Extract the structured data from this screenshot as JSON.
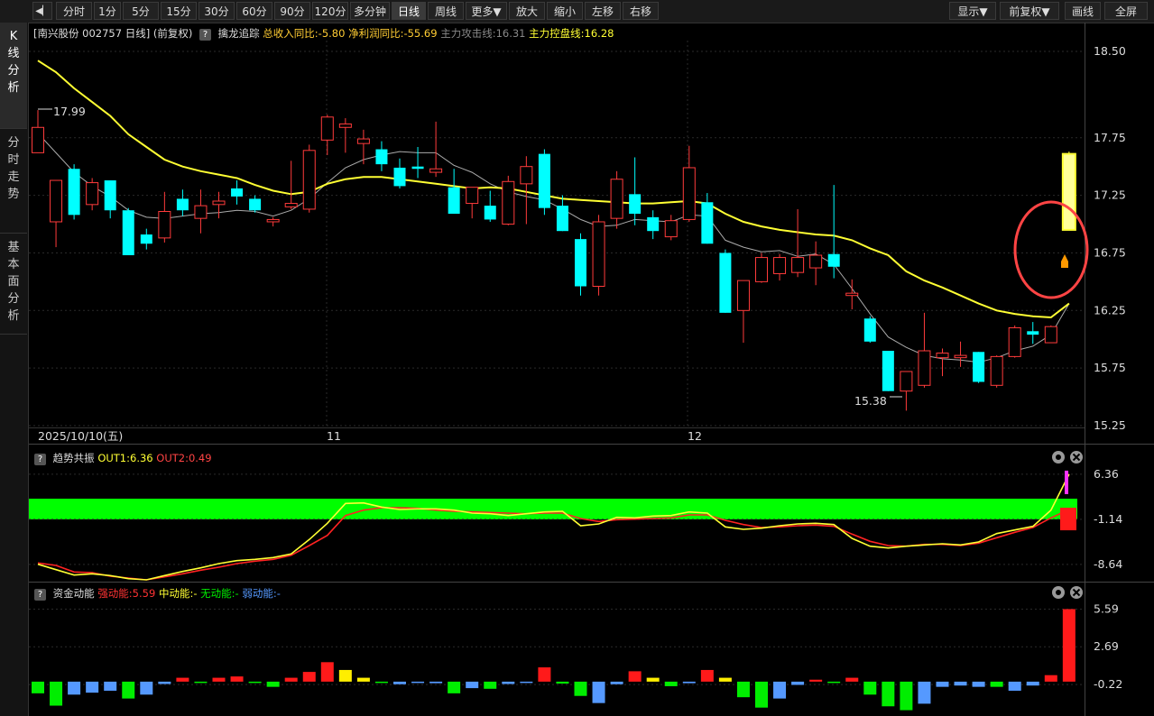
{
  "toolbar": {
    "items": [
      "分时",
      "1分",
      "5分",
      "15分",
      "30分",
      "60分",
      "90分",
      "120分",
      "多分钟",
      "日线",
      "周线",
      "更多▼",
      "放大",
      "缩小",
      "左移",
      "右移"
    ],
    "active": "日线",
    "right_items": [
      "显示▼",
      "前复权▼",
      "画线",
      "全屏"
    ]
  },
  "sidebar": {
    "tabs": [
      {
        "label": "K\n线\n分\n析",
        "active": true
      },
      {
        "label": "分\n时\n走\n势",
        "active": false
      },
      {
        "label": "基\n本\n面\n分\n析",
        "active": false
      }
    ]
  },
  "main": {
    "stock": "[南兴股份 002757 日线]",
    "adjust": "(前复权)",
    "indicator_name": "擒龙追踪",
    "rev_yoy": "总收入同比:-5.80",
    "profit_yoy": "净利润同比:-55.69",
    "attack_line": "主力攻击线:16.31",
    "control_line": "主力控盘线:16.28",
    "high_label": "17.99",
    "low_label": "15.38",
    "date_label": "2025/10/10(五)",
    "month_labels": [
      "11",
      "12"
    ],
    "y_ticks": [
      "18.50",
      "17.75",
      "17.25",
      "16.75",
      "16.25",
      "15.75",
      "15.25"
    ]
  },
  "panel2": {
    "name": "趋势共振",
    "out1": "OUT1:6.36",
    "out2": "OUT2:0.49",
    "y_ticks": [
      "6.36",
      "-1.14",
      "-8.64"
    ]
  },
  "panel3": {
    "name": "资金动能",
    "strong": "强动能:5.59",
    "mid": "中动能:-",
    "none": "无动能:-",
    "weak": "弱动能:-",
    "y_ticks": [
      "5.59",
      "2.69",
      "-0.22"
    ]
  },
  "colors": {
    "up": "#ff3b3b",
    "down": "#00ffff",
    "ma_yellow": "#ffff33",
    "ma_gray": "#aaaaaa",
    "band_green": "#00ff00",
    "bar_red": "#ff1a1a",
    "bar_yellow": "#ffee00",
    "bar_green": "#00ee00",
    "bar_blue": "#5599ff",
    "highlight": "#ff4444"
  },
  "chart_data": [
    {
      "type": "candlestick",
      "ylim": [
        15.25,
        18.5
      ],
      "candles": [
        {
          "o": 17.62,
          "h": 17.99,
          "l": 17.62,
          "c": 17.84
        },
        {
          "o": 17.02,
          "h": 17.38,
          "l": 16.8,
          "c": 17.38
        },
        {
          "o": 17.48,
          "h": 17.52,
          "l": 17.04,
          "c": 17.08
        },
        {
          "o": 17.17,
          "h": 17.4,
          "l": 17.12,
          "c": 17.36
        },
        {
          "o": 17.38,
          "h": 17.38,
          "l": 17.05,
          "c": 17.12
        },
        {
          "o": 17.12,
          "h": 17.14,
          "l": 16.73,
          "c": 16.73
        },
        {
          "o": 16.91,
          "h": 16.96,
          "l": 16.78,
          "c": 16.83
        },
        {
          "o": 16.88,
          "h": 17.28,
          "l": 16.84,
          "c": 17.11
        },
        {
          "o": 17.22,
          "h": 17.3,
          "l": 17.07,
          "c": 17.12
        },
        {
          "o": 17.05,
          "h": 17.3,
          "l": 16.92,
          "c": 17.16
        },
        {
          "o": 17.17,
          "h": 17.28,
          "l": 17.05,
          "c": 17.2
        },
        {
          "o": 17.31,
          "h": 17.38,
          "l": 17.17,
          "c": 17.24
        },
        {
          "o": 17.22,
          "h": 17.25,
          "l": 17.1,
          "c": 17.12
        },
        {
          "o": 17.02,
          "h": 17.06,
          "l": 16.98,
          "c": 17.04
        },
        {
          "o": 17.15,
          "h": 17.55,
          "l": 17.13,
          "c": 17.18
        },
        {
          "o": 17.13,
          "h": 17.69,
          "l": 17.1,
          "c": 17.64
        },
        {
          "o": 17.73,
          "h": 17.95,
          "l": 17.6,
          "c": 17.93
        },
        {
          "o": 17.84,
          "h": 17.92,
          "l": 17.62,
          "c": 17.87
        },
        {
          "o": 17.7,
          "h": 17.82,
          "l": 17.52,
          "c": 17.74
        },
        {
          "o": 17.65,
          "h": 17.72,
          "l": 17.46,
          "c": 17.52
        },
        {
          "o": 17.49,
          "h": 17.57,
          "l": 17.31,
          "c": 17.33
        },
        {
          "o": 17.5,
          "h": 17.67,
          "l": 17.4,
          "c": 17.48
        },
        {
          "o": 17.45,
          "h": 17.89,
          "l": 17.41,
          "c": 17.48
        },
        {
          "o": 17.32,
          "h": 17.48,
          "l": 17.12,
          "c": 17.09
        },
        {
          "o": 17.18,
          "h": 17.32,
          "l": 17.05,
          "c": 17.32
        },
        {
          "o": 17.16,
          "h": 17.29,
          "l": 17.02,
          "c": 17.04
        },
        {
          "o": 17.0,
          "h": 17.42,
          "l": 16.99,
          "c": 17.37
        },
        {
          "o": 17.35,
          "h": 17.59,
          "l": 17.0,
          "c": 17.5
        },
        {
          "o": 17.61,
          "h": 17.65,
          "l": 17.08,
          "c": 17.14
        },
        {
          "o": 17.16,
          "h": 17.25,
          "l": 16.94,
          "c": 16.94
        },
        {
          "o": 16.87,
          "h": 16.92,
          "l": 16.38,
          "c": 16.46
        },
        {
          "o": 16.46,
          "h": 17.08,
          "l": 16.38,
          "c": 17.02
        },
        {
          "o": 17.05,
          "h": 17.46,
          "l": 16.96,
          "c": 17.39
        },
        {
          "o": 17.26,
          "h": 17.58,
          "l": 16.99,
          "c": 17.09
        },
        {
          "o": 17.06,
          "h": 17.12,
          "l": 16.87,
          "c": 16.94
        },
        {
          "o": 16.89,
          "h": 17.08,
          "l": 16.86,
          "c": 17.03
        },
        {
          "o": 17.04,
          "h": 17.68,
          "l": 17.02,
          "c": 17.49
        },
        {
          "o": 17.19,
          "h": 17.27,
          "l": 16.87,
          "c": 16.83
        },
        {
          "o": 16.75,
          "h": 16.78,
          "l": 16.41,
          "c": 16.23
        },
        {
          "o": 16.25,
          "h": 16.45,
          "l": 15.97,
          "c": 16.51
        },
        {
          "o": 16.5,
          "h": 16.75,
          "l": 16.49,
          "c": 16.71
        },
        {
          "o": 16.57,
          "h": 16.74,
          "l": 16.51,
          "c": 16.71
        },
        {
          "o": 16.58,
          "h": 17.13,
          "l": 16.54,
          "c": 16.71
        },
        {
          "o": 16.62,
          "h": 16.85,
          "l": 16.47,
          "c": 16.73
        },
        {
          "o": 16.74,
          "h": 17.34,
          "l": 16.53,
          "c": 16.63
        },
        {
          "o": 16.38,
          "h": 16.52,
          "l": 16.26,
          "c": 16.4
        },
        {
          "o": 16.18,
          "h": 16.2,
          "l": 15.97,
          "c": 15.98
        },
        {
          "o": 15.9,
          "h": 15.9,
          "l": 15.55,
          "c": 15.55
        },
        {
          "o": 15.55,
          "h": 15.38,
          "l": 15.38,
          "c": 15.72
        },
        {
          "o": 15.6,
          "h": 16.23,
          "l": 15.58,
          "c": 15.9
        },
        {
          "o": 15.84,
          "h": 15.92,
          "l": 15.68,
          "c": 15.88
        },
        {
          "o": 15.84,
          "h": 15.98,
          "l": 15.76,
          "c": 15.86
        },
        {
          "o": 15.89,
          "h": 15.89,
          "l": 15.62,
          "c": 15.63
        },
        {
          "o": 15.6,
          "h": 15.86,
          "l": 15.58,
          "c": 15.85
        },
        {
          "o": 15.85,
          "h": 16.12,
          "l": 15.84,
          "c": 16.1
        },
        {
          "o": 16.07,
          "h": 16.15,
          "l": 15.96,
          "c": 16.04
        },
        {
          "o": 15.97,
          "h": 16.12,
          "l": 15.97,
          "c": 16.11
        },
        {
          "o": 16.95,
          "h": 17.63,
          "l": 16.95,
          "c": 17.61
        }
      ],
      "ma_yellow": [
        18.42,
        18.32,
        18.18,
        18.06,
        17.94,
        17.78,
        17.67,
        17.56,
        17.5,
        17.46,
        17.43,
        17.4,
        17.34,
        17.29,
        17.26,
        17.28,
        17.35,
        17.39,
        17.41,
        17.41,
        17.39,
        17.37,
        17.35,
        17.33,
        17.31,
        17.32,
        17.31,
        17.28,
        17.25,
        17.22,
        17.21,
        17.2,
        17.19,
        17.18,
        17.18,
        17.19,
        17.2,
        17.18,
        17.09,
        17.02,
        16.98,
        16.95,
        16.93,
        16.91,
        16.9,
        16.86,
        16.79,
        16.73,
        16.59,
        16.51,
        16.45,
        16.38,
        16.31,
        16.25,
        16.22,
        16.2,
        16.19,
        16.31
      ],
      "ma_gray": [
        17.79,
        17.62,
        17.45,
        17.33,
        17.24,
        17.12,
        17.06,
        17.05,
        17.07,
        17.09,
        17.1,
        17.12,
        17.11,
        17.07,
        17.12,
        17.22,
        17.36,
        17.49,
        17.56,
        17.6,
        17.63,
        17.62,
        17.62,
        17.51,
        17.45,
        17.35,
        17.28,
        17.24,
        17.21,
        17.13,
        17.04,
        16.98,
        16.99,
        17.04,
        17.03,
        17.02,
        17.08,
        17.07,
        16.86,
        16.8,
        16.76,
        16.77,
        16.72,
        16.74,
        16.65,
        16.44,
        16.22,
        16.02,
        15.93,
        15.86,
        15.83,
        15.82,
        15.8,
        15.84,
        15.9,
        15.94,
        16.04,
        16.31
      ]
    },
    {
      "type": "line",
      "ylim": [
        -11.5,
        8.0
      ],
      "band": [
        -1.14,
        0.8
      ],
      "series": [
        {
          "name": "OUT1",
          "values": [
            -8.6,
            -9.5,
            -10.4,
            -10.2,
            -10.5,
            -11.0,
            -11.2,
            -10.5,
            -9.8,
            -9.2,
            -8.5,
            -8.0,
            -7.8,
            -7.5,
            -6.9,
            -4.5,
            -1.8,
            1.5,
            1.6,
            0.9,
            0.5,
            0.6,
            0.6,
            0.4,
            -0.1,
            -0.2,
            -0.5,
            -0.2,
            0.1,
            0.2,
            -2.2,
            -1.9,
            -0.8,
            -0.9,
            -0.6,
            -0.5,
            0.1,
            -0.1,
            -2.4,
            -2.8,
            -2.6,
            -2.2,
            -1.9,
            -1.8,
            -2.0,
            -4.3,
            -5.6,
            -5.9,
            -5.6,
            -5.4,
            -5.2,
            -5.4,
            -4.9,
            -3.5,
            -2.9,
            -2.3,
            0.4,
            6.36
          ]
        },
        {
          "name": "OUT2",
          "values": [
            -8.4,
            -8.8,
            -9.9,
            -10.0,
            -10.6,
            -10.9,
            -11.2,
            -10.7,
            -10.2,
            -9.6,
            -9.1,
            -8.5,
            -8.1,
            -7.8,
            -7.1,
            -5.5,
            -3.8,
            -0.5,
            0.4,
            0.8,
            0.8,
            0.7,
            0.4,
            0.2,
            0.1,
            0.0,
            -0.1,
            -0.2,
            -0.1,
            -0.1,
            -1.0,
            -1.5,
            -1.2,
            -1.1,
            -1.0,
            -0.9,
            -0.4,
            -0.4,
            -1.3,
            -2.0,
            -2.5,
            -2.4,
            -2.2,
            -2.1,
            -2.3,
            -3.6,
            -4.8,
            -5.5,
            -5.6,
            -5.3,
            -5.3,
            -5.5,
            -5.1,
            -4.2,
            -3.3,
            -2.5,
            -0.9,
            0.49
          ]
        }
      ]
    },
    {
      "type": "bar",
      "ylim": [
        -2.3,
        5.9
      ],
      "values": [
        -0.9,
        -1.85,
        -1.0,
        -0.85,
        -0.7,
        -1.3,
        -1.0,
        -0.18,
        0.3,
        -0.1,
        0.3,
        0.4,
        -0.1,
        -0.4,
        0.3,
        0.75,
        1.5,
        0.9,
        0.3,
        -0.1,
        -0.2,
        -0.1,
        -0.12,
        -0.9,
        -0.5,
        -0.55,
        -0.18,
        -0.06,
        1.1,
        -0.15,
        -1.1,
        -1.65,
        -0.2,
        0.8,
        0.3,
        -0.35,
        -0.12,
        0.9,
        0.3,
        -1.2,
        -2.0,
        -1.3,
        -0.25,
        0.15,
        -0.02,
        0.3,
        -1.0,
        -1.9,
        -2.2,
        -1.7,
        -0.4,
        -0.3,
        -0.4,
        -0.4,
        -0.7,
        -0.3,
        0.5,
        5.59
      ],
      "colors": [
        "G",
        "G",
        "B",
        "B",
        "B",
        "G",
        "B",
        "B",
        "R",
        "G",
        "R",
        "R",
        "G",
        "G",
        "R",
        "R",
        "R",
        "Y",
        "Y",
        "G",
        "B",
        "B",
        "B",
        "G",
        "B",
        "G",
        "B",
        "B",
        "R",
        "G",
        "G",
        "B",
        "B",
        "R",
        "Y",
        "G",
        "B",
        "R",
        "Y",
        "G",
        "G",
        "B",
        "B",
        "R",
        "G",
        "R",
        "G",
        "G",
        "G",
        "B",
        "B",
        "B",
        "B",
        "G",
        "B",
        "B",
        "R",
        "R",
        "Y",
        "Y",
        "R"
      ]
    }
  ]
}
